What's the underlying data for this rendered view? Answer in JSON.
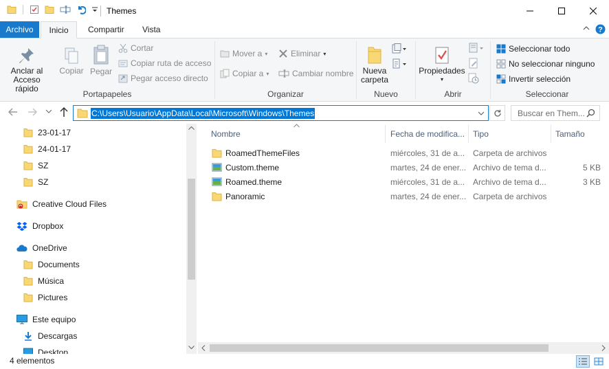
{
  "window": {
    "title": "Themes",
    "controls": {
      "minimize": "—",
      "maximize": "☐",
      "close": "✕"
    }
  },
  "ribbon_tabs": [
    {
      "label": "Archivo"
    },
    {
      "label": "Inicio"
    },
    {
      "label": "Compartir"
    },
    {
      "label": "Vista"
    }
  ],
  "ribbon": {
    "clipboard": {
      "pin_line1": "Anclar al",
      "pin_line2": "Acceso rápido",
      "copy": "Copiar",
      "paste": "Pegar",
      "cut": "Cortar",
      "copy_path": "Copiar ruta de acceso",
      "paste_shortcut": "Pegar acceso directo",
      "label": "Portapapeles"
    },
    "organize": {
      "move_to": "Mover a",
      "copy_to": "Copiar a",
      "delete": "Eliminar",
      "rename": "Cambiar nombre",
      "label": "Organizar"
    },
    "new": {
      "new_folder_line1": "Nueva",
      "new_folder_line2": "carpeta",
      "label": "Nuevo"
    },
    "open": {
      "properties": "Propiedades",
      "label": "Abrir"
    },
    "select": {
      "select_all": "Seleccionar todo",
      "select_none": "No seleccionar ninguno",
      "invert": "Invertir selección",
      "label": "Seleccionar"
    }
  },
  "address": {
    "path": "C:\\Users\\Usuario\\AppData\\Local\\Microsoft\\Windows\\Themes",
    "search_placeholder": "Buscar en Them..."
  },
  "nav_pane": {
    "items": [
      {
        "label": "23-01-17",
        "icon": "folder-icon"
      },
      {
        "label": "24-01-17",
        "icon": "folder-icon"
      },
      {
        "label": "SZ",
        "icon": "folder-icon"
      },
      {
        "label": "SZ",
        "icon": "folder-icon"
      },
      {
        "label": "Creative Cloud Files",
        "icon": "creative-cloud-icon"
      },
      {
        "label": "Dropbox",
        "icon": "dropbox-icon"
      },
      {
        "label": "OneDrive",
        "icon": "onedrive-icon"
      },
      {
        "label": "Documents",
        "icon": "folder-icon"
      },
      {
        "label": "Música",
        "icon": "folder-icon"
      },
      {
        "label": "Pictures",
        "icon": "folder-icon"
      },
      {
        "label": "Este equipo",
        "icon": "computer-icon"
      },
      {
        "label": "Descargas",
        "icon": "download-icon"
      },
      {
        "label": "Desktop",
        "icon": "desktop-icon"
      }
    ]
  },
  "file_list": {
    "columns": {
      "name": "Nombre",
      "date": "Fecha de modifica...",
      "type": "Tipo",
      "size": "Tamaño"
    },
    "rows": [
      {
        "name": "RoamedThemeFiles",
        "date": "miércoles, 31 de a...",
        "type": "Carpeta de archivos",
        "size": "",
        "icon": "folder-icon"
      },
      {
        "name": "Custom.theme",
        "date": "martes, 24 de ener...",
        "type": "Archivo de tema d...",
        "size": "5 KB",
        "icon": "theme-file-icon"
      },
      {
        "name": "Roamed.theme",
        "date": "miércoles, 31 de a...",
        "type": "Archivo de tema d...",
        "size": "3 KB",
        "icon": "theme-file-icon"
      },
      {
        "name": "Panoramic",
        "date": "martes, 24 de ener...",
        "type": "Carpeta de archivos",
        "size": "",
        "icon": "folder-icon"
      }
    ]
  },
  "status_bar": {
    "count": "4 elementos"
  },
  "colors": {
    "accent": "#1979ca",
    "selection": "#0078d7",
    "folder": "#f8d775",
    "folder_dark": "#e0b33f"
  }
}
